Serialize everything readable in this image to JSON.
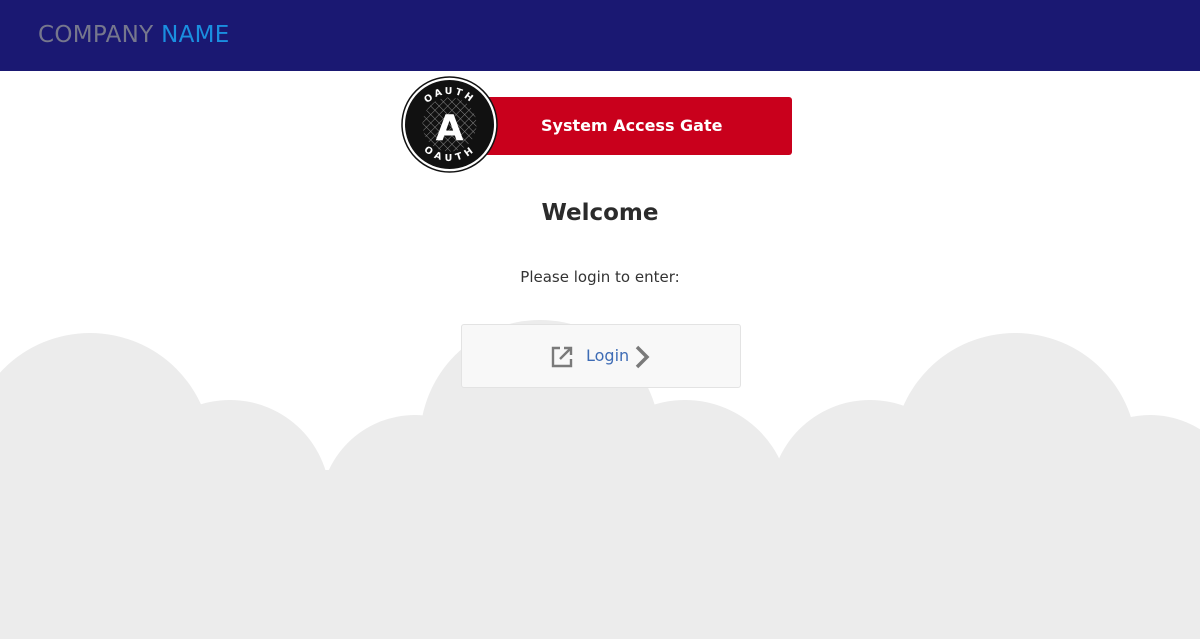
{
  "header": {
    "brand_first": "COMPANY",
    "brand_second": "NAME",
    "background_color": "#1a1872",
    "brand_first_color": "#76778d",
    "brand_second_color": "#1a8fe0"
  },
  "gate": {
    "logo_ring_top": "OAUTH",
    "logo_ring_bottom": "OAUTH",
    "logo_letter": "A",
    "logo_icon": "oauth-logo-icon",
    "title": "System Access Gate",
    "accent_color": "#c9001c"
  },
  "main": {
    "heading": "Welcome",
    "prompt": "Please login to enter:"
  },
  "login": {
    "label": "Login",
    "icon": "external-link-icon",
    "arrow_icon": "chevron-right-icon",
    "label_color": "#3e6cb5"
  },
  "background": {
    "cloud_color": "#ececec"
  }
}
